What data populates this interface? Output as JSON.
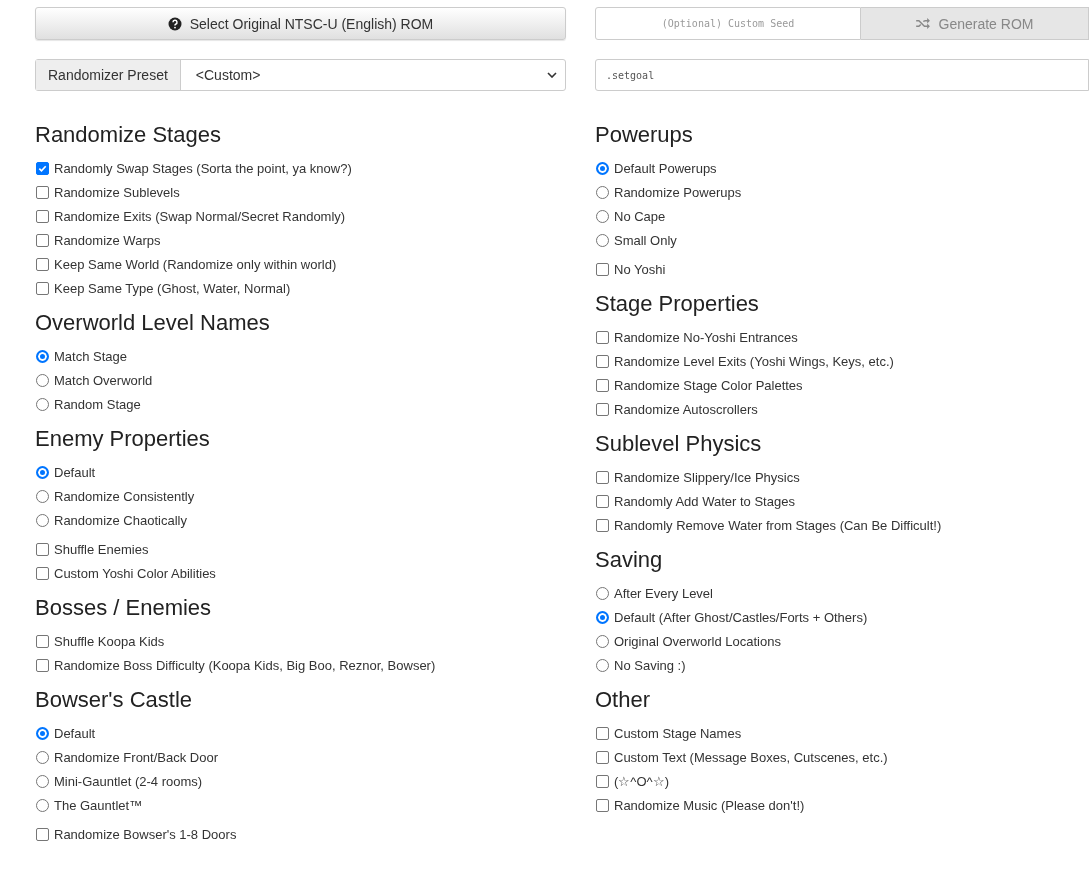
{
  "rom_button": {
    "label": "Select Original NTSC-U (English) ROM"
  },
  "preset": {
    "label": "Randomizer Preset",
    "value": "<Custom>"
  },
  "seed_field": {
    "placeholder": "(Optional) Custom Seed"
  },
  "generate_button": {
    "label": "Generate ROM",
    "disabled": true
  },
  "command_field": {
    "value": ".setgoal"
  },
  "left_sections": [
    {
      "title": "Randomize Stages",
      "options": [
        {
          "kind": "checkbox",
          "label": "Randomly Swap Stages (Sorta the point, ya know?)",
          "checked": true
        },
        {
          "kind": "checkbox",
          "label": "Randomize Sublevels",
          "checked": false
        },
        {
          "kind": "checkbox",
          "label": "Randomize Exits (Swap Normal/Secret Randomly)",
          "checked": false
        },
        {
          "kind": "checkbox",
          "label": "Randomize Warps",
          "checked": false
        },
        {
          "kind": "checkbox",
          "label": "Keep Same World (Randomize only within world)",
          "checked": false
        },
        {
          "kind": "checkbox",
          "label": "Keep Same Type (Ghost, Water, Normal)",
          "checked": false
        }
      ]
    },
    {
      "title": "Overworld Level Names",
      "options": [
        {
          "kind": "radio",
          "label": "Match Stage",
          "checked": true
        },
        {
          "kind": "radio",
          "label": "Match Overworld",
          "checked": false
        },
        {
          "kind": "radio",
          "label": "Random Stage",
          "checked": false
        }
      ]
    },
    {
      "title": "Enemy Properties",
      "options": [
        {
          "kind": "radio",
          "label": "Default",
          "checked": true
        },
        {
          "kind": "radio",
          "label": "Randomize Consistently",
          "checked": false
        },
        {
          "kind": "radio",
          "label": "Randomize Chaotically",
          "checked": false
        },
        {
          "kind": "checkbox",
          "label": "Shuffle Enemies",
          "checked": false
        },
        {
          "kind": "checkbox",
          "label": "Custom Yoshi Color Abilities",
          "checked": false
        }
      ]
    },
    {
      "title": "Bosses / Enemies",
      "options": [
        {
          "kind": "checkbox",
          "label": "Shuffle Koopa Kids",
          "checked": false
        },
        {
          "kind": "checkbox",
          "label": "Randomize Boss Difficulty (Koopa Kids, Big Boo, Reznor, Bowser)",
          "checked": false
        }
      ]
    },
    {
      "title": "Bowser's Castle",
      "options": [
        {
          "kind": "radio",
          "label": "Default",
          "checked": true
        },
        {
          "kind": "radio",
          "label": "Randomize Front/Back Door",
          "checked": false
        },
        {
          "kind": "radio",
          "label": "Mini-Gauntlet (2-4 rooms)",
          "checked": false
        },
        {
          "kind": "radio",
          "label": "The Gauntlet™",
          "checked": false
        },
        {
          "kind": "checkbox",
          "label": "Randomize Bowser's 1-8 Doors",
          "checked": false
        }
      ]
    }
  ],
  "right_sections": [
    {
      "title": "Powerups",
      "options": [
        {
          "kind": "radio",
          "label": "Default Powerups",
          "checked": true
        },
        {
          "kind": "radio",
          "label": "Randomize Powerups",
          "checked": false
        },
        {
          "kind": "radio",
          "label": "No Cape",
          "checked": false
        },
        {
          "kind": "radio",
          "label": "Small Only",
          "checked": false
        },
        {
          "kind": "checkbox",
          "label": "No Yoshi",
          "checked": false
        }
      ]
    },
    {
      "title": "Stage Properties",
      "options": [
        {
          "kind": "checkbox",
          "label": "Randomize No-Yoshi Entrances",
          "checked": false
        },
        {
          "kind": "checkbox",
          "label": "Randomize Level Exits (Yoshi Wings, Keys, etc.)",
          "checked": false
        },
        {
          "kind": "checkbox",
          "label": "Randomize Stage Color Palettes",
          "checked": false
        },
        {
          "kind": "checkbox",
          "label": "Randomize Autoscrollers",
          "checked": false
        }
      ]
    },
    {
      "title": "Sublevel Physics",
      "options": [
        {
          "kind": "checkbox",
          "label": "Randomize Slippery/Ice Physics",
          "checked": false
        },
        {
          "kind": "checkbox",
          "label": "Randomly Add Water to Stages",
          "checked": false
        },
        {
          "kind": "checkbox",
          "label": "Randomly Remove Water from Stages (Can Be Difficult!)",
          "checked": false
        }
      ]
    },
    {
      "title": "Saving",
      "options": [
        {
          "kind": "radio",
          "label": "After Every Level",
          "checked": false
        },
        {
          "kind": "radio",
          "label": "Default (After Ghost/Castles/Forts + Others)",
          "checked": true
        },
        {
          "kind": "radio",
          "label": "Original Overworld Locations",
          "checked": false
        },
        {
          "kind": "radio",
          "label": "No Saving :)",
          "checked": false
        }
      ]
    },
    {
      "title": "Other",
      "options": [
        {
          "kind": "checkbox",
          "label": "Custom Stage Names",
          "checked": false
        },
        {
          "kind": "checkbox",
          "label": "Custom Text (Message Boxes, Cutscenes, etc.)",
          "checked": false
        },
        {
          "kind": "checkbox",
          "label": "(☆^O^☆)",
          "checked": false
        },
        {
          "kind": "checkbox",
          "label": "Randomize Music (Please don't!)",
          "checked": false
        }
      ]
    }
  ]
}
